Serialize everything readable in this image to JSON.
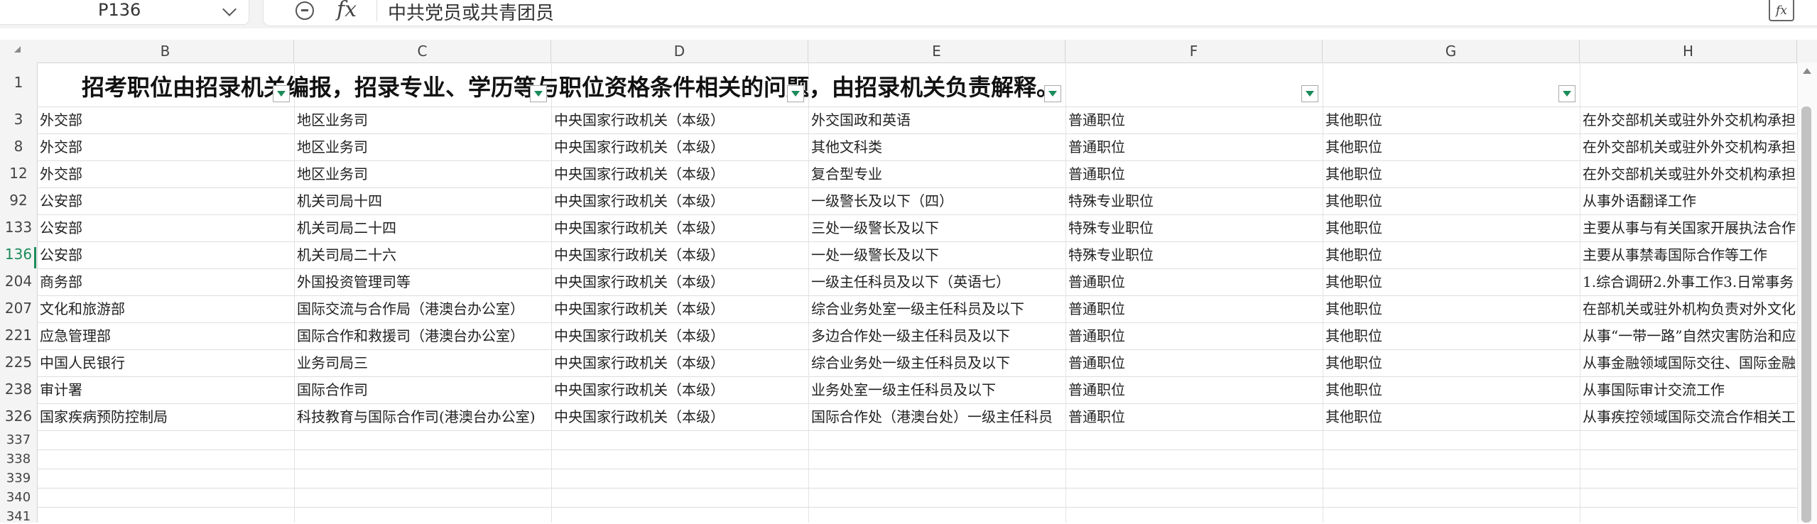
{
  "name_box": {
    "value": "P136"
  },
  "formula_bar": {
    "content": "中共党员或共青团员",
    "fx_label": "fx"
  },
  "columns": [
    "B",
    "C",
    "D",
    "E",
    "F",
    "G",
    "H"
  ],
  "title": "招考职位由招录机关编报，招录专业、学历等与职位资格条件相关的问题，由招录机关负责解释。",
  "rows": [
    {
      "num": "1",
      "cells": []
    },
    {
      "num": "3",
      "cells": [
        "外交部",
        "地区业务司",
        "中央国家行政机关（本级）",
        "外交国政和英语",
        "普通职位",
        "其他职位",
        "在外交部机关或驻外外交机构承担"
      ]
    },
    {
      "num": "8",
      "cells": [
        "外交部",
        "地区业务司",
        "中央国家行政机关（本级）",
        "其他文科类",
        "普通职位",
        "其他职位",
        "在外交部机关或驻外外交机构承担"
      ]
    },
    {
      "num": "12",
      "cells": [
        "外交部",
        "地区业务司",
        "中央国家行政机关（本级）",
        "复合型专业",
        "普通职位",
        "其他职位",
        "在外交部机关或驻外外交机构承担"
      ]
    },
    {
      "num": "92",
      "cells": [
        "公安部",
        "机关司局十四",
        "中央国家行政机关（本级）",
        "一级警长及以下（四）",
        "特殊专业职位",
        "其他职位",
        "从事外语翻译工作"
      ]
    },
    {
      "num": "133",
      "cells": [
        "公安部",
        "机关司局二十四",
        "中央国家行政机关（本级）",
        "三处一级警长及以下",
        "特殊专业职位",
        "其他职位",
        "主要从事与有关国家开展执法合作"
      ]
    },
    {
      "num": "136",
      "cells": [
        "公安部",
        "机关司局二十六",
        "中央国家行政机关（本级）",
        "一处一级警长及以下",
        "特殊专业职位",
        "其他职位",
        "主要从事禁毒国际合作等工作"
      ]
    },
    {
      "num": "204",
      "cells": [
        "商务部",
        "外国投资管理司等",
        "中央国家行政机关（本级）",
        "一级主任科员及以下（英语七）",
        "普通职位",
        "其他职位",
        "1.综合调研2.外事工作3.日常事务"
      ]
    },
    {
      "num": "207",
      "cells": [
        "文化和旅游部",
        "国际交流与合作局（港澳台办公室）",
        "中央国家行政机关（本级）",
        "综合业务处室一级主任科员及以下",
        "普通职位",
        "其他职位",
        "在部机关或驻外机构负责对外文化"
      ]
    },
    {
      "num": "221",
      "cells": [
        "应急管理部",
        "国际合作和救援司（港澳台办公室）",
        "中央国家行政机关（本级）",
        "多边合作处一级主任科员及以下",
        "普通职位",
        "其他职位",
        "从事“一带一路”自然灾害防治和应急"
      ]
    },
    {
      "num": "225",
      "cells": [
        "中国人民银行",
        "业务司局三",
        "中央国家行政机关（本级）",
        "综合业务处一级主任科员及以下",
        "普通职位",
        "其他职位",
        "从事金融领域国际交往、国际金融"
      ]
    },
    {
      "num": "238",
      "cells": [
        "审计署",
        "国际合作司",
        "中央国家行政机关（本级）",
        "业务处室一级主任科员及以下",
        "普通职位",
        "其他职位",
        "从事国际审计交流工作"
      ]
    },
    {
      "num": "326",
      "cells": [
        "国家疾病预防控制局",
        "科技教育与国际合作司(港澳台办公室)",
        "中央国家行政机关（本级）",
        "国际合作处（港澳台处）一级主任科员",
        "普通职位",
        "其他职位",
        "从事疾控领域国际交流合作相关工作"
      ]
    },
    {
      "num": "337",
      "cells": []
    },
    {
      "num": "338",
      "cells": []
    },
    {
      "num": "339",
      "cells": []
    },
    {
      "num": "340",
      "cells": []
    },
    {
      "num": "341",
      "cells": []
    }
  ]
}
